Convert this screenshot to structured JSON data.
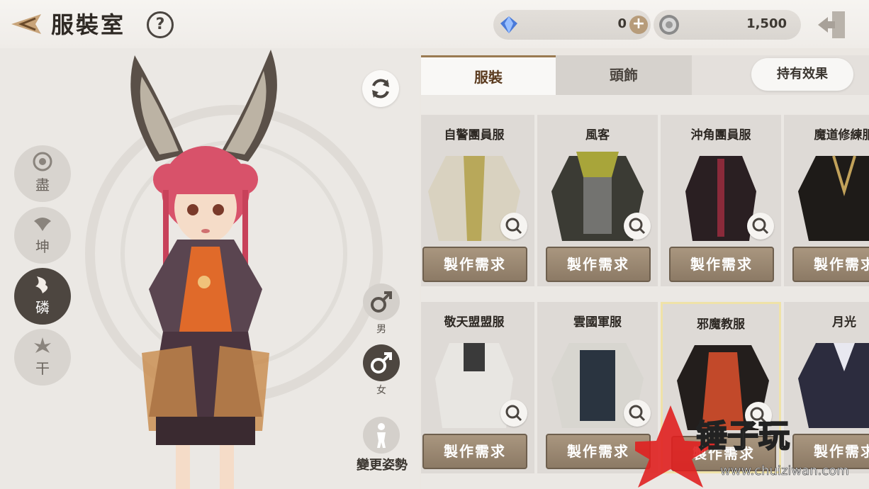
{
  "header": {
    "title": "服裝室",
    "help_label": "?",
    "currency_gem": {
      "value": "0",
      "plus": "+"
    },
    "currency_silver": {
      "value": "1,500"
    }
  },
  "classes": [
    {
      "label": "盡",
      "icon": "gourd-emblem-icon",
      "active": false
    },
    {
      "label": "坤",
      "icon": "beast-emblem-icon",
      "active": false
    },
    {
      "label": "磷",
      "icon": "phoenix-emblem-icon",
      "active": true
    },
    {
      "label": "干",
      "icon": "lotus-emblem-icon",
      "active": false
    }
  ],
  "character_controls": {
    "male_label": "男",
    "female_label": "女",
    "pose_label": "變更姿勢",
    "selected_gender": "female"
  },
  "tabs": [
    {
      "label": "服裝",
      "active": true
    },
    {
      "label": "頭飾",
      "active": false
    }
  ],
  "effect_button": "持有效果",
  "costumes": [
    {
      "name": "自警團員服",
      "craft": "製作需求",
      "color": "#d9d2c0",
      "accent": "#b8a85a",
      "selected": false
    },
    {
      "name": "風客",
      "craft": "製作需求",
      "color": "#3b3b34",
      "accent": "#a8a53a",
      "selected": false
    },
    {
      "name": "沖角團員服",
      "craft": "製作需求",
      "color": "#2a1f22",
      "accent": "#8a2a3a",
      "selected": false
    },
    {
      "name": "魔道修練服",
      "craft": "製作需求",
      "color": "#1e1b18",
      "accent": "#c2a25a",
      "selected": false
    },
    {
      "name": "敬天盟盟服",
      "craft": "製作需求",
      "color": "#e8e6e2",
      "accent": "#3a3a3a",
      "selected": false
    },
    {
      "name": "雲國軍服",
      "craft": "製作需求",
      "color": "#2a3440",
      "accent": "#d8d6d0",
      "selected": false
    },
    {
      "name": "邪魔教服",
      "craft": "製作需求",
      "color": "#231e1c",
      "accent": "#c2492a",
      "selected": true
    },
    {
      "name": "月光",
      "craft": "製作需求",
      "color": "#2c2c3e",
      "accent": "#e8e8f0",
      "selected": false
    }
  ],
  "watermark": {
    "text": "锤子玩",
    "url": "www.chuiziwan.com"
  }
}
